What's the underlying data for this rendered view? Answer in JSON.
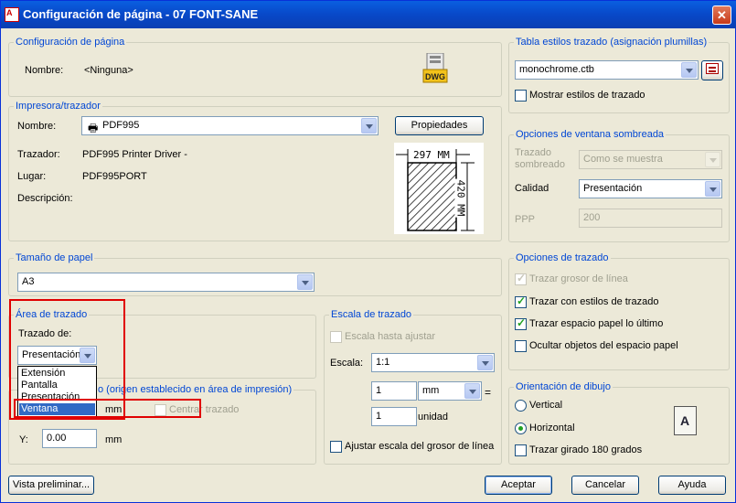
{
  "window": {
    "title": "Configuración de página - 07 FONT-SANE",
    "app_badge": "A",
    "close_glyph": "✕"
  },
  "page_setup": {
    "group_label": "Configuración de página",
    "name_label": "Nombre:",
    "name_value": "<Ninguna>",
    "dwg_badge": "DWG"
  },
  "printer": {
    "group_label": "Impresora/trazador",
    "name_label": "Nombre:",
    "name_value": "PDF995",
    "properties_label": "Propiedades",
    "plotter_label": "Trazador:",
    "plotter_value": "PDF995 Printer Driver -",
    "location_label": "Lugar:",
    "location_value": "PDF995PORT",
    "description_label": "Descripción:",
    "paper_width": "297 MM",
    "paper_height": "420 MM"
  },
  "paper_size": {
    "group_label": "Tamaño de papel",
    "value": "A3"
  },
  "plot_area": {
    "group_label": "Área de trazado",
    "plot_from_label": "Trazado de:",
    "plot_from_value": "Presentación",
    "options": [
      "Extensión",
      "Pantalla",
      "Presentación",
      "Ventana"
    ],
    "selected": "Ventana"
  },
  "plot_offset": {
    "group_label": "Desfase de trazado (origen establecido en área de impresión)",
    "group_label_visible": "o (origen establecido en área de impresión)",
    "x_unit": "mm",
    "center_label": "Centrar trazado",
    "y_label": "Y:",
    "y_value": "0.00",
    "y_unit": "mm"
  },
  "plot_scale": {
    "group_label": "Escala de trazado",
    "fit_label": "Escala hasta ajustar",
    "scale_label": "Escala:",
    "scale_value": "1:1",
    "numerator": "1",
    "unit_value": "mm",
    "equals": "=",
    "denominator": "1",
    "denominator_unit": "unidad",
    "lineweights_label": "Ajustar escala del grosor de línea"
  },
  "plot_style_table": {
    "group_label": "Tabla estilos trazado (asignación plumillas)",
    "value": "monochrome.ctb",
    "show_styles_label": "Mostrar estilos de trazado"
  },
  "shaded_viewport": {
    "group_label": "Opciones de ventana sombreada",
    "shade_label_1": "Trazado",
    "shade_label_2": "sombreado",
    "shade_value": "Como se muestra",
    "quality_label": "Calidad",
    "quality_value": "Presentación",
    "dpi_label": "PPP",
    "dpi_value": "200"
  },
  "plot_options": {
    "group_label": "Opciones de trazado",
    "items": [
      {
        "label": "Trazar grosor de línea",
        "checked": true,
        "disabled": true
      },
      {
        "label": "Trazar con estilos de trazado",
        "checked": true,
        "disabled": false
      },
      {
        "label": "Trazar espacio papel lo último",
        "checked": true,
        "disabled": false
      },
      {
        "label": "Ocultar objetos del espacio papel",
        "checked": false,
        "disabled": false
      }
    ]
  },
  "orientation": {
    "group_label": "Orientación de dibujo",
    "portrait_label": "Vertical",
    "landscape_label": "Horizontal",
    "selected": "Horizontal",
    "upside_down_label": "Trazar girado 180 grados",
    "preview_letter": "A"
  },
  "footer": {
    "preview_label": "Vista preliminar...",
    "ok_label": "Aceptar",
    "cancel_label": "Cancelar",
    "help_label": "Ayuda"
  },
  "colors": {
    "titlebar": "#0a5fe0",
    "group_label": "#0046d5",
    "highlight": "#e00000",
    "selection": "#316ac5"
  }
}
